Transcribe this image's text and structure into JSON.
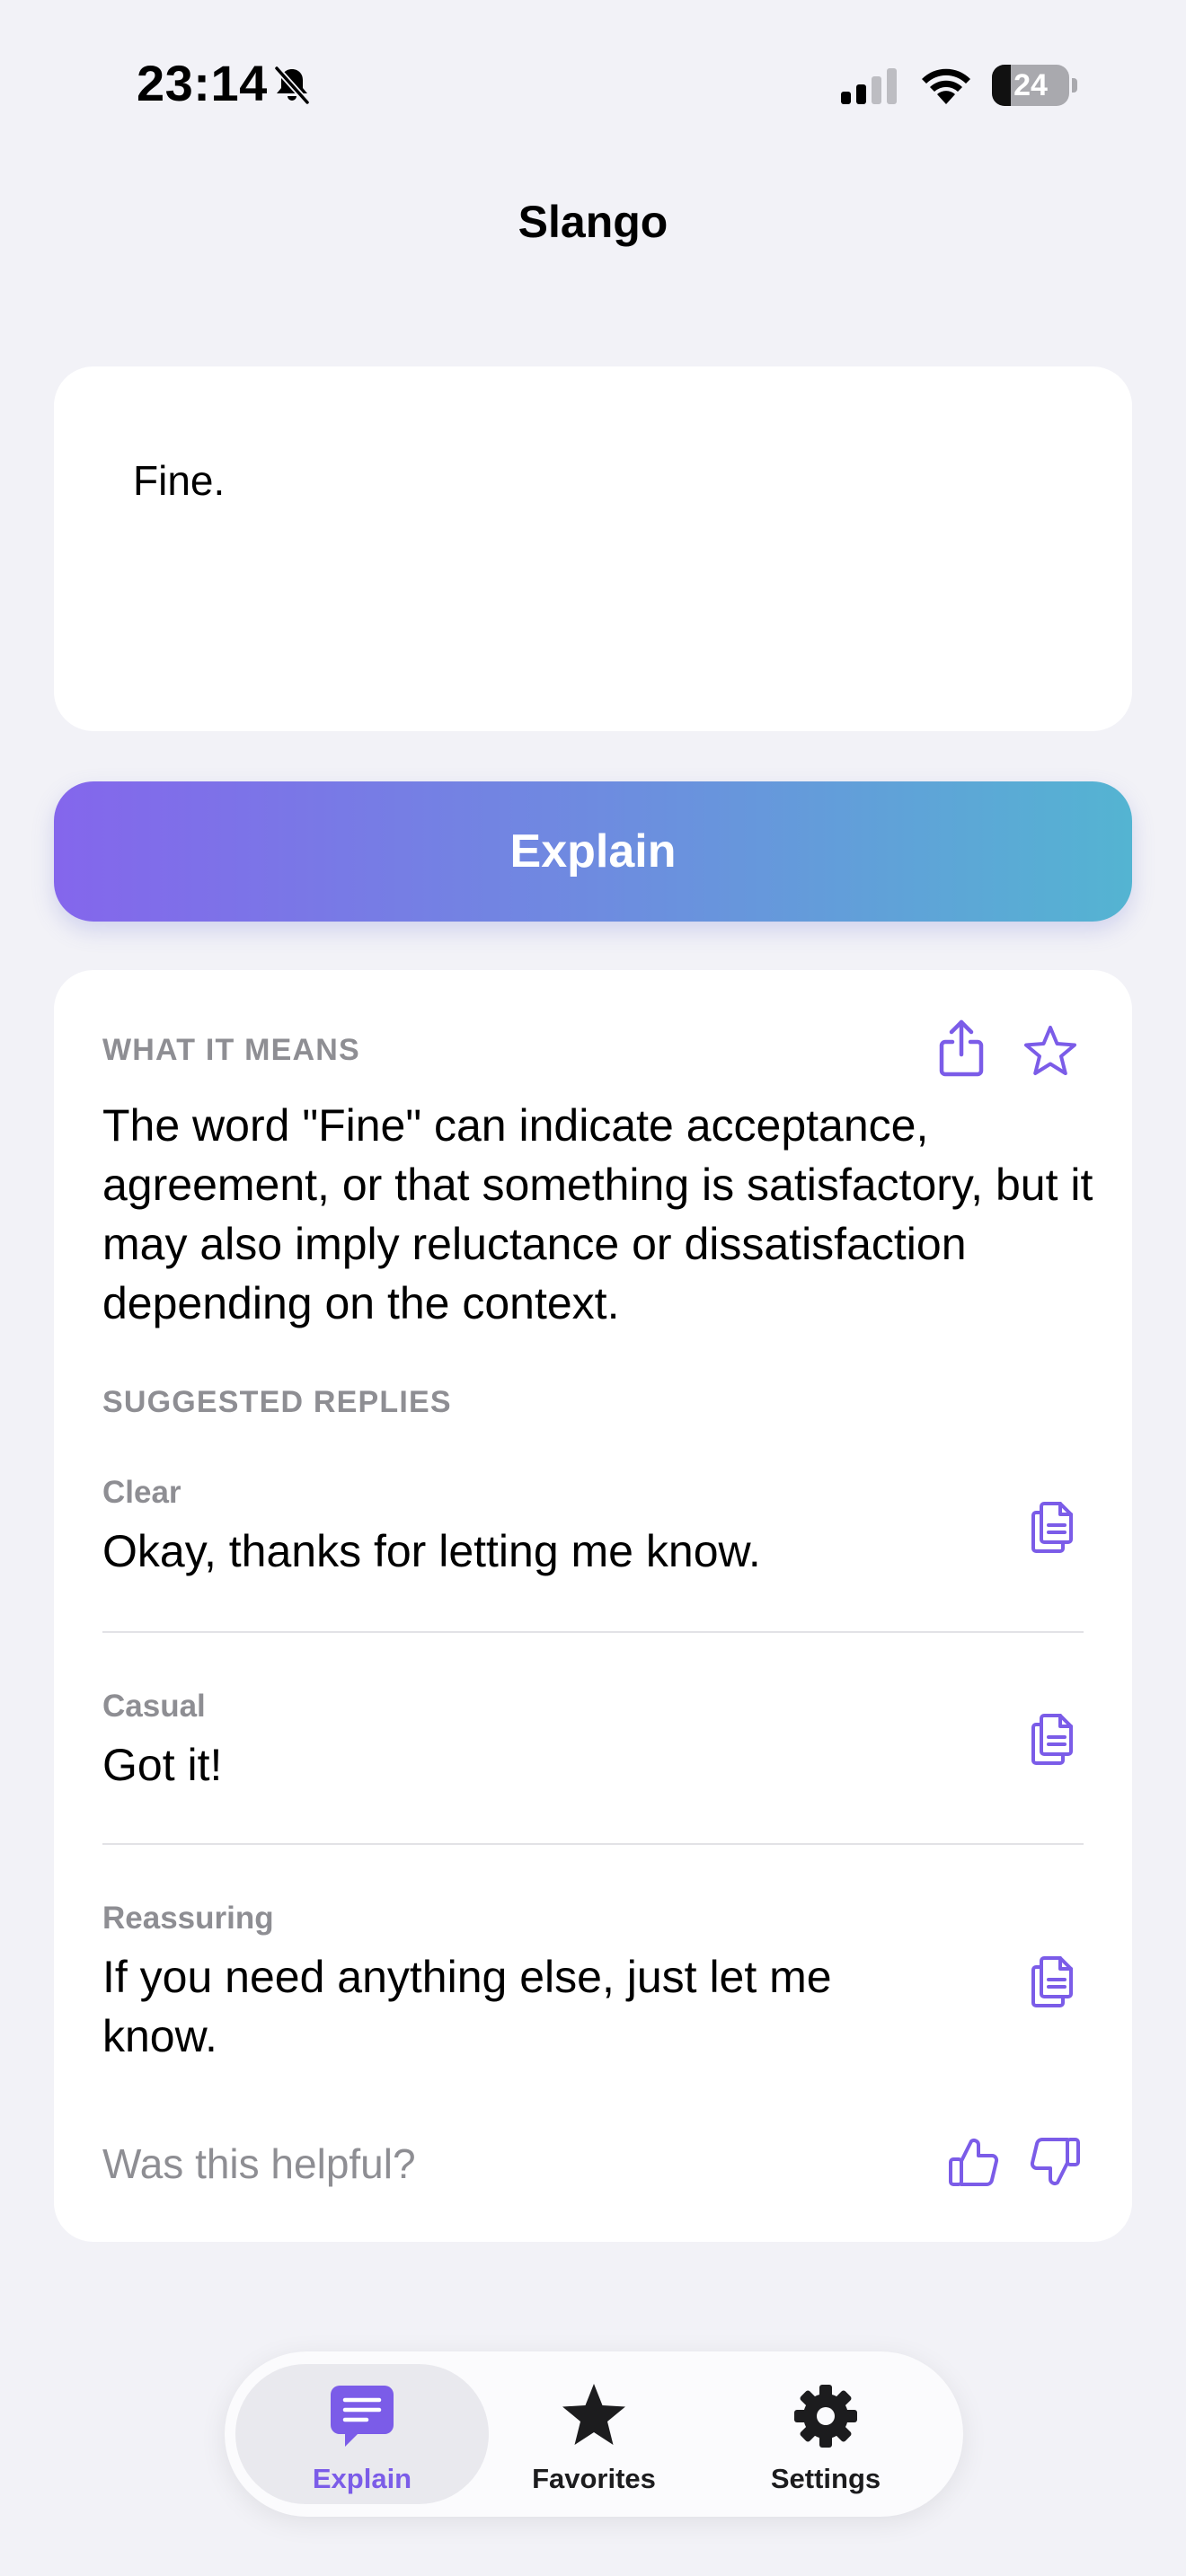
{
  "status_bar": {
    "time": "23:14",
    "battery_level": "24",
    "battery_fraction": 0.24
  },
  "header": {
    "title": "Slango"
  },
  "input": {
    "value": "Fine."
  },
  "explain_button": {
    "label": "Explain"
  },
  "result": {
    "meaning_label": "WHAT IT MEANS",
    "meaning_text": "The word \"Fine\" can indicate acceptance, agreement, or that something is satisfactory, but it may also imply reluctance or dissatisfaction depending on the context.",
    "replies_label": "SUGGESTED REPLIES",
    "replies": [
      {
        "tone": "Clear",
        "text": "Okay, thanks for letting me know."
      },
      {
        "tone": "Casual",
        "text": "Got it!"
      },
      {
        "tone": "Reassuring",
        "text": "If you need anything else, just let me know."
      }
    ],
    "feedback_prompt": "Was this helpful?"
  },
  "tabs": [
    {
      "label": "Explain",
      "icon": "chat-bubble-icon",
      "active": true
    },
    {
      "label": "Favorites",
      "icon": "star-icon",
      "active": false
    },
    {
      "label": "Settings",
      "icon": "gear-icon",
      "active": false
    }
  ],
  "colors": {
    "accent": "#7b5ce8",
    "gradient_start": "#8466ec",
    "gradient_end": "#54b4d2",
    "background": "#f2f2f7",
    "secondary_text": "#8e8e93"
  }
}
